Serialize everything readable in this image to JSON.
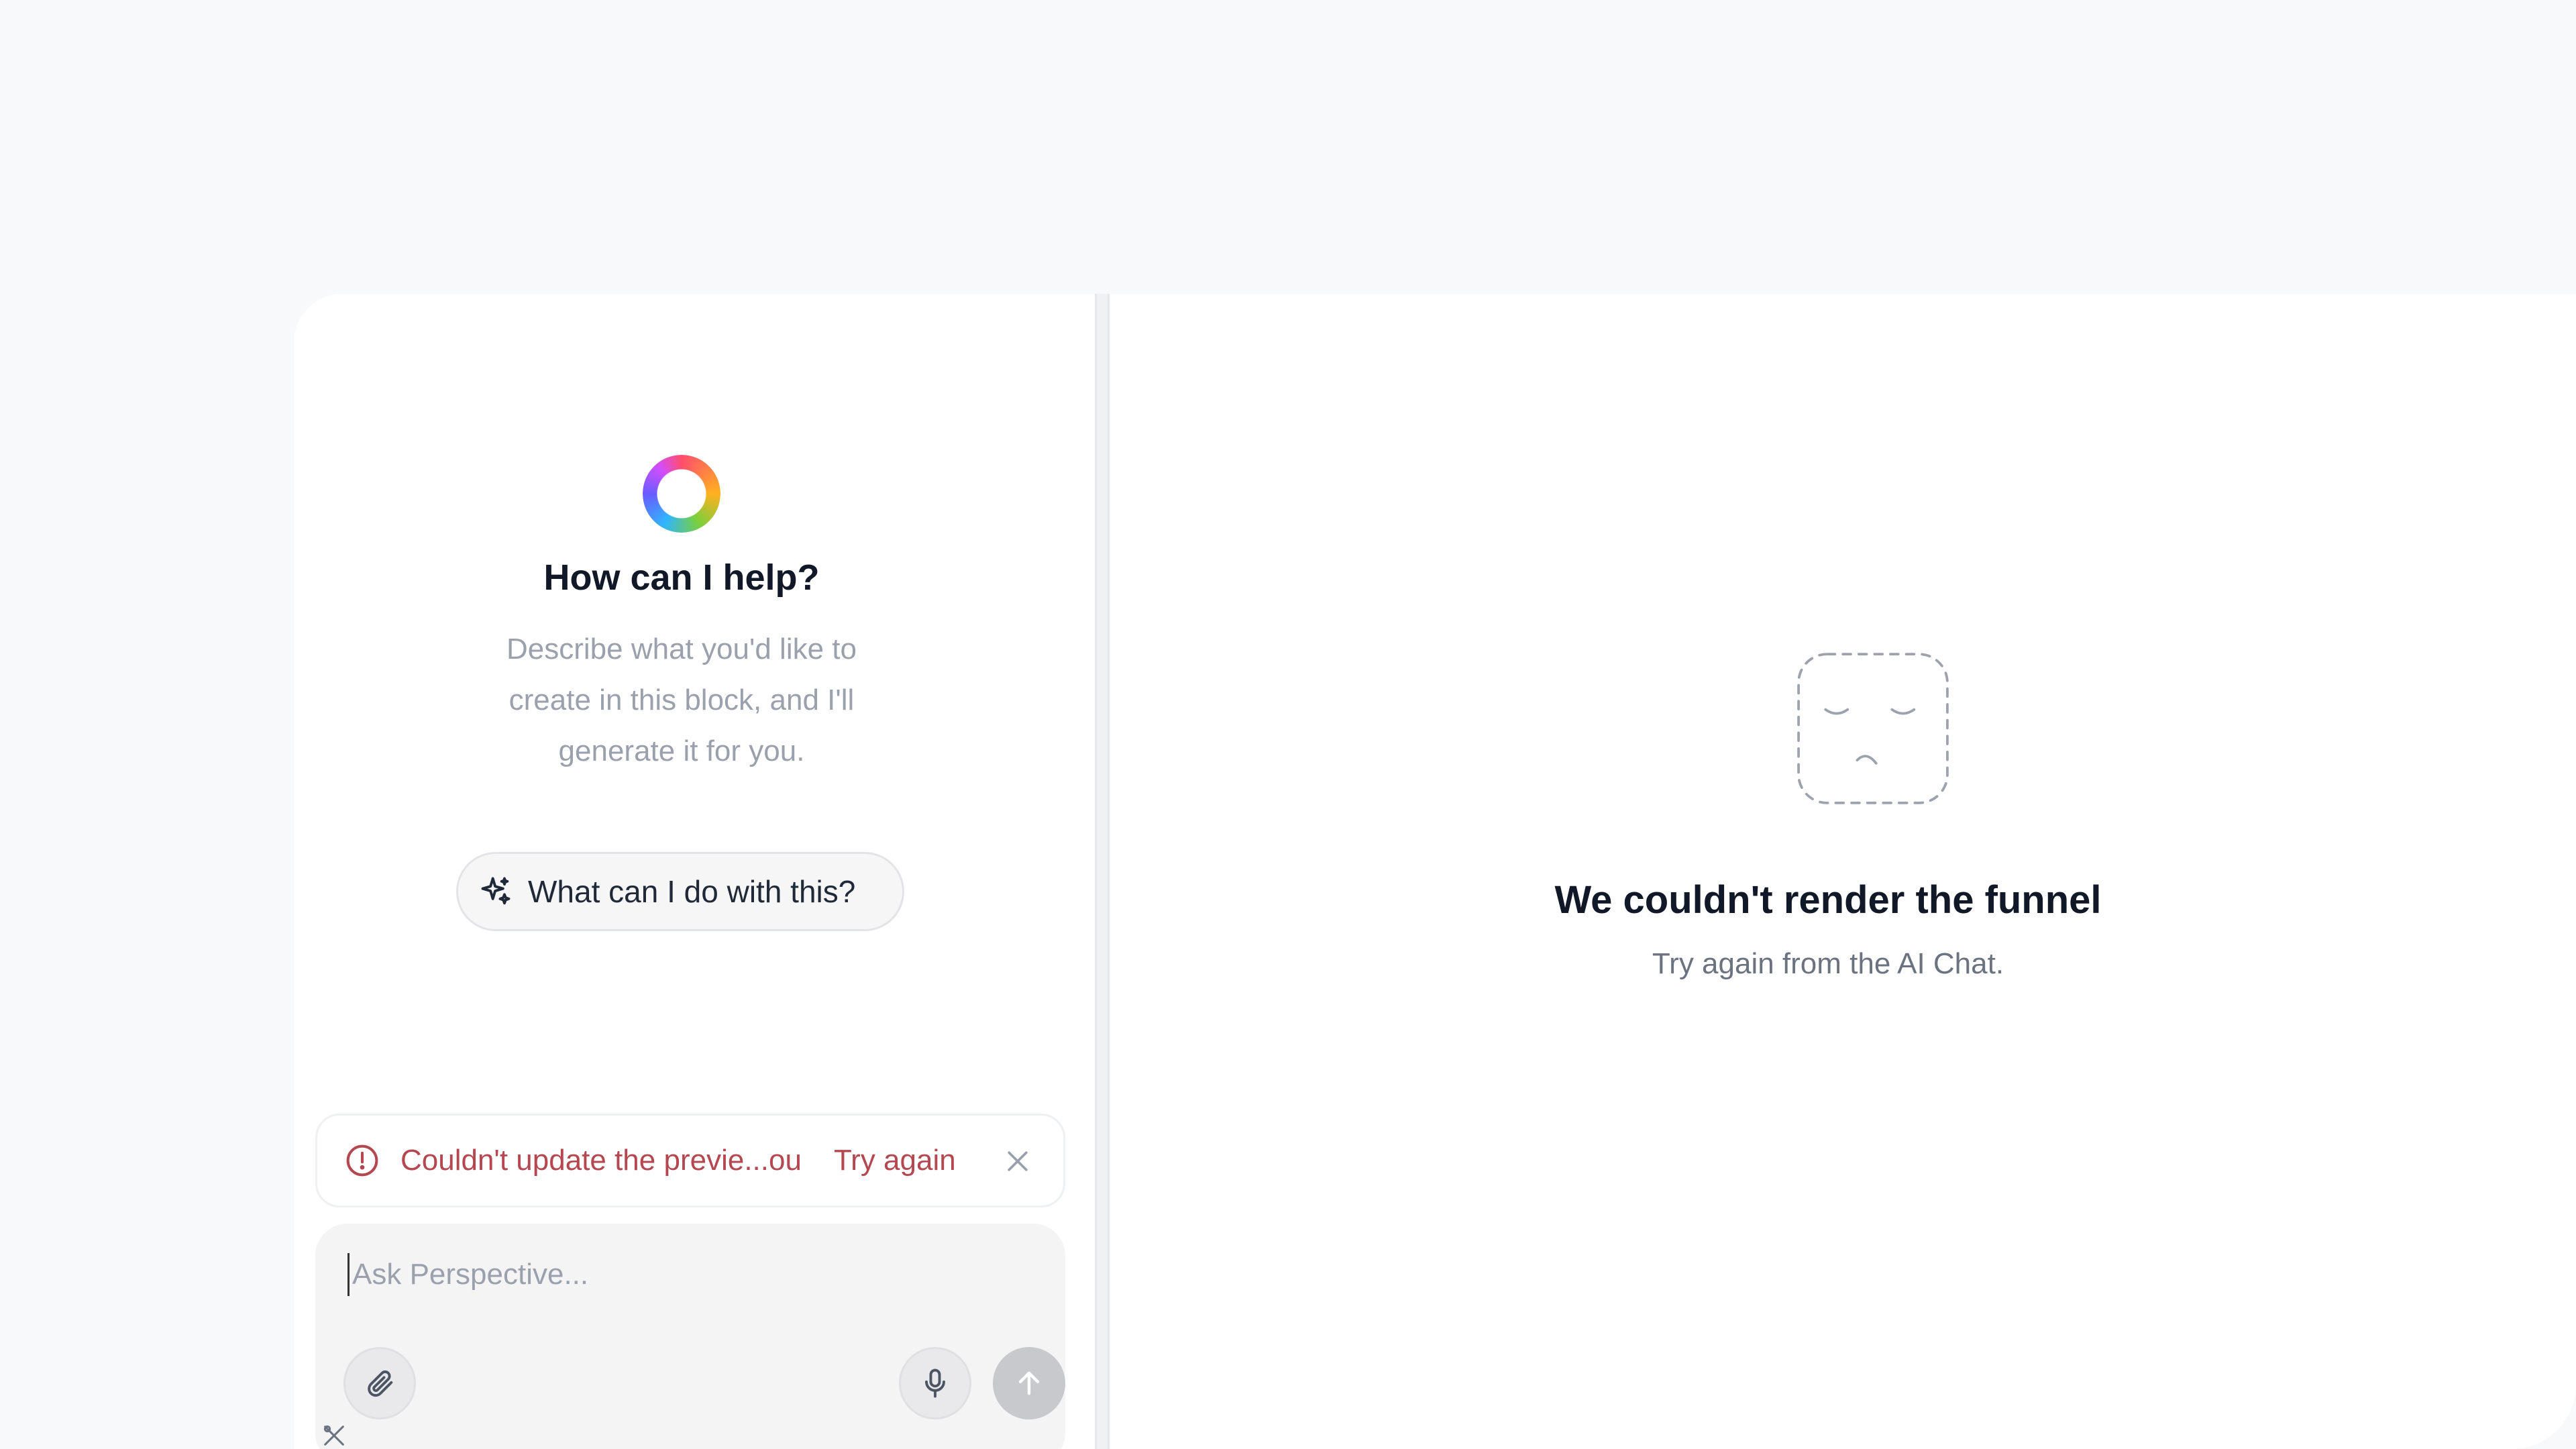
{
  "chat": {
    "title": "How can I help?",
    "description": "Describe what you'd like to create in this block, and I'll generate it for you.",
    "suggestion": "What can I do with this?",
    "error": {
      "message": "Couldn't update the previe...ou",
      "retry_label": "Try again"
    },
    "composer": {
      "placeholder": "Ask Perspective..."
    }
  },
  "preview": {
    "title": "We couldn't render the funnel",
    "subtitle": "Try again from the AI Chat."
  },
  "colors": {
    "error": "#b4474f",
    "background": "#f8f9fb",
    "title": "#111827"
  },
  "icons": {
    "logo": "gradient-ring-icon",
    "suggestion": "sparkles-icon",
    "error": "alert-circle-icon",
    "dismiss": "close-icon",
    "attach": "paperclip-icon",
    "mic": "microphone-icon",
    "send": "arrow-up-icon",
    "preview_empty": "sad-face-icon"
  }
}
